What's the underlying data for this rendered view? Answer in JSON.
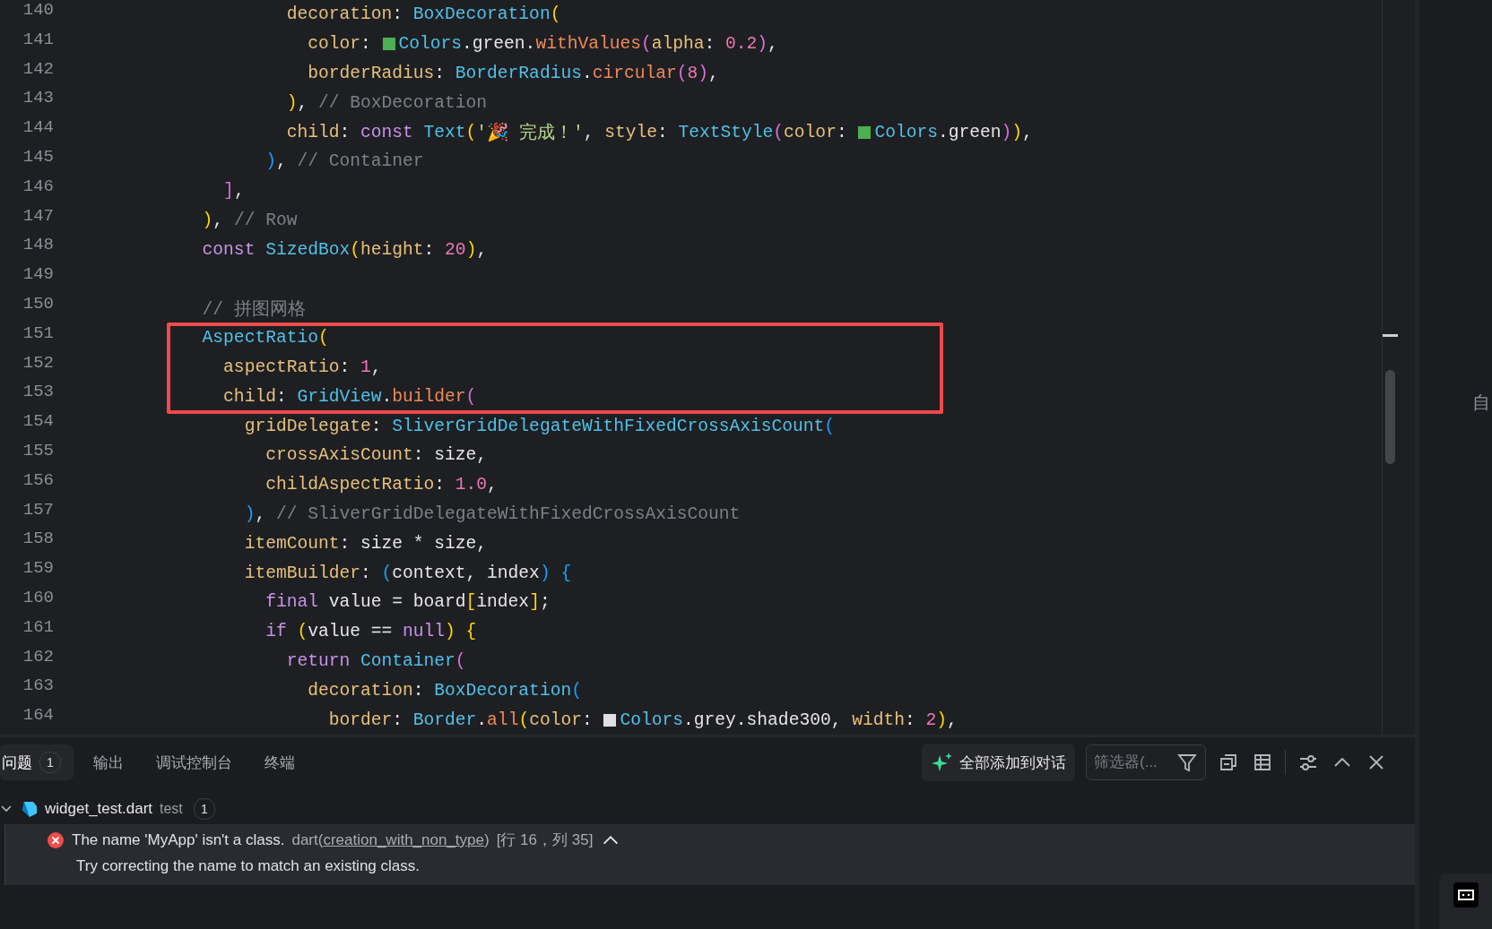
{
  "editor": {
    "lines": [
      {
        "number": "140",
        "tokens": [
          {
            "kind": "prop",
            "s": "                  decoration"
          },
          {
            "kind": "text",
            "s": ": "
          },
          {
            "kind": "type",
            "s": "BoxDecoration"
          },
          {
            "kind": "b1",
            "s": "("
          }
        ]
      },
      {
        "number": "141",
        "tokens": [
          {
            "kind": "prop",
            "s": "                    color"
          },
          {
            "kind": "text",
            "s": ": "
          },
          {
            "kind": "swatch",
            "color": "#4caf50"
          },
          {
            "kind": "type",
            "s": "Colors"
          },
          {
            "kind": "text",
            "s": ".green."
          },
          {
            "kind": "fn",
            "s": "withValues"
          },
          {
            "kind": "b2",
            "s": "("
          },
          {
            "kind": "prop",
            "s": "alpha"
          },
          {
            "kind": "text",
            "s": ": "
          },
          {
            "kind": "num",
            "s": "0.2"
          },
          {
            "kind": "b2",
            "s": ")"
          },
          {
            "kind": "text",
            "s": ","
          }
        ]
      },
      {
        "number": "142",
        "tokens": [
          {
            "kind": "prop",
            "s": "                    borderRadius"
          },
          {
            "kind": "text",
            "s": ": "
          },
          {
            "kind": "type",
            "s": "BorderRadius"
          },
          {
            "kind": "text",
            "s": "."
          },
          {
            "kind": "fn",
            "s": "circular"
          },
          {
            "kind": "b2",
            "s": "("
          },
          {
            "kind": "num",
            "s": "8"
          },
          {
            "kind": "b2",
            "s": ")"
          },
          {
            "kind": "text",
            "s": ","
          }
        ]
      },
      {
        "number": "143",
        "tokens": [
          {
            "kind": "b1",
            "s": "                  )"
          },
          {
            "kind": "text",
            "s": ", "
          },
          {
            "kind": "comment",
            "s": "// BoxDecoration"
          }
        ]
      },
      {
        "number": "144",
        "tokens": [
          {
            "kind": "prop",
            "s": "                  child"
          },
          {
            "kind": "text",
            "s": ": "
          },
          {
            "kind": "kw",
            "s": "const "
          },
          {
            "kind": "type",
            "s": "Text"
          },
          {
            "kind": "b1",
            "s": "("
          },
          {
            "kind": "str",
            "s": "'🎉 完成！'"
          },
          {
            "kind": "text",
            "s": ", "
          },
          {
            "kind": "prop",
            "s": "style"
          },
          {
            "kind": "text",
            "s": ": "
          },
          {
            "kind": "type",
            "s": "TextStyle"
          },
          {
            "kind": "b2",
            "s": "("
          },
          {
            "kind": "prop",
            "s": "color"
          },
          {
            "kind": "text",
            "s": ": "
          },
          {
            "kind": "swatch",
            "color": "#4caf50"
          },
          {
            "kind": "type",
            "s": "Colors"
          },
          {
            "kind": "text",
            "s": ".green"
          },
          {
            "kind": "b2",
            "s": ")"
          },
          {
            "kind": "b1",
            "s": ")"
          },
          {
            "kind": "text",
            "s": ","
          }
        ]
      },
      {
        "number": "145",
        "tokens": [
          {
            "kind": "b3",
            "s": "                )"
          },
          {
            "kind": "text",
            "s": ", "
          },
          {
            "kind": "comment",
            "s": "// Container"
          }
        ]
      },
      {
        "number": "146",
        "tokens": [
          {
            "kind": "b2",
            "s": "            ]"
          },
          {
            "kind": "text",
            "s": ","
          }
        ]
      },
      {
        "number": "147",
        "tokens": [
          {
            "kind": "b1",
            "s": "          )"
          },
          {
            "kind": "text",
            "s": ", "
          },
          {
            "kind": "comment",
            "s": "// Row"
          }
        ]
      },
      {
        "number": "148",
        "tokens": [
          {
            "kind": "kw",
            "s": "          const "
          },
          {
            "kind": "type",
            "s": "SizedBox"
          },
          {
            "kind": "b1",
            "s": "("
          },
          {
            "kind": "prop",
            "s": "height"
          },
          {
            "kind": "text",
            "s": ": "
          },
          {
            "kind": "num",
            "s": "20"
          },
          {
            "kind": "b1",
            "s": ")"
          },
          {
            "kind": "text",
            "s": ","
          }
        ]
      },
      {
        "number": "149"
      },
      {
        "number": "150",
        "tokens": [
          {
            "kind": "comment",
            "s": "          // 拼图网格"
          }
        ]
      },
      {
        "number": "151",
        "boxed": true,
        "tokens": [
          {
            "kind": "type",
            "s": "          AspectRatio"
          },
          {
            "kind": "b1",
            "s": "("
          }
        ]
      },
      {
        "number": "152",
        "boxed": true,
        "tokens": [
          {
            "kind": "prop",
            "s": "            aspectRatio"
          },
          {
            "kind": "text",
            "s": ": "
          },
          {
            "kind": "num",
            "s": "1"
          },
          {
            "kind": "text",
            "s": ","
          }
        ]
      },
      {
        "number": "153",
        "boxed": true,
        "tokens": [
          {
            "kind": "prop",
            "s": "            child"
          },
          {
            "kind": "text",
            "s": ": "
          },
          {
            "kind": "type",
            "s": "GridView"
          },
          {
            "kind": "text",
            "s": "."
          },
          {
            "kind": "fn",
            "s": "builder"
          },
          {
            "kind": "b2",
            "s": "("
          }
        ]
      },
      {
        "number": "154",
        "tokens": [
          {
            "kind": "prop",
            "s": "              gridDelegate"
          },
          {
            "kind": "text",
            "s": ": "
          },
          {
            "kind": "type",
            "s": "SliverGridDelegateWithFixedCrossAxisCount"
          },
          {
            "kind": "b3",
            "s": "("
          }
        ]
      },
      {
        "number": "155",
        "tokens": [
          {
            "kind": "prop",
            "s": "                crossAxisCount"
          },
          {
            "kind": "text",
            "s": ": size,"
          }
        ]
      },
      {
        "number": "156",
        "tokens": [
          {
            "kind": "prop",
            "s": "                childAspectRatio"
          },
          {
            "kind": "text",
            "s": ": "
          },
          {
            "kind": "num",
            "s": "1.0"
          },
          {
            "kind": "text",
            "s": ","
          }
        ]
      },
      {
        "number": "157",
        "tokens": [
          {
            "kind": "b3",
            "s": "              )"
          },
          {
            "kind": "text",
            "s": ", "
          },
          {
            "kind": "comment",
            "s": "// SliverGridDelegateWithFixedCrossAxisCount"
          }
        ]
      },
      {
        "number": "158",
        "tokens": [
          {
            "kind": "prop",
            "s": "              itemCount"
          },
          {
            "kind": "text",
            "s": ": size * size,"
          }
        ]
      },
      {
        "number": "159",
        "tokens": [
          {
            "kind": "prop",
            "s": "              itemBuilder"
          },
          {
            "kind": "text",
            "s": ": "
          },
          {
            "kind": "b3",
            "s": "("
          },
          {
            "kind": "text",
            "s": "context, index"
          },
          {
            "kind": "b3",
            "s": ")"
          },
          {
            "kind": "b3",
            "s": " {"
          }
        ]
      },
      {
        "number": "160",
        "tokens": [
          {
            "kind": "kw",
            "s": "                final "
          },
          {
            "kind": "text",
            "s": "value = board"
          },
          {
            "kind": "b1",
            "s": "["
          },
          {
            "kind": "text",
            "s": "index"
          },
          {
            "kind": "b1",
            "s": "]"
          },
          {
            "kind": "text",
            "s": ";"
          }
        ]
      },
      {
        "number": "161",
        "tokens": [
          {
            "kind": "kw",
            "s": "                if "
          },
          {
            "kind": "b1",
            "s": "("
          },
          {
            "kind": "text",
            "s": "value == "
          },
          {
            "kind": "kw",
            "s": "null"
          },
          {
            "kind": "b1",
            "s": ")"
          },
          {
            "kind": "b1",
            "s": " {"
          }
        ]
      },
      {
        "number": "162",
        "tokens": [
          {
            "kind": "kw",
            "s": "                  return "
          },
          {
            "kind": "type",
            "s": "Container"
          },
          {
            "kind": "b2",
            "s": "("
          }
        ]
      },
      {
        "number": "163",
        "tokens": [
          {
            "kind": "prop",
            "s": "                    decoration"
          },
          {
            "kind": "text",
            "s": ": "
          },
          {
            "kind": "type",
            "s": "BoxDecoration"
          },
          {
            "kind": "b3",
            "s": "("
          }
        ]
      },
      {
        "number": "164",
        "tokens": [
          {
            "kind": "prop",
            "s": "                      border"
          },
          {
            "kind": "text",
            "s": ": "
          },
          {
            "kind": "type",
            "s": "Border"
          },
          {
            "kind": "text",
            "s": "."
          },
          {
            "kind": "fn",
            "s": "all"
          },
          {
            "kind": "b1",
            "s": "("
          },
          {
            "kind": "prop",
            "s": "color"
          },
          {
            "kind": "text",
            "s": ": "
          },
          {
            "kind": "swatch",
            "color": "#e0e0e0"
          },
          {
            "kind": "type",
            "s": "Colors"
          },
          {
            "kind": "text",
            "s": ".grey.shade300, "
          },
          {
            "kind": "prop",
            "s": "width"
          },
          {
            "kind": "text",
            "s": ": "
          },
          {
            "kind": "num",
            "s": "2"
          },
          {
            "kind": "b1",
            "s": ")"
          },
          {
            "kind": "text",
            "s": ","
          }
        ]
      }
    ]
  },
  "panel": {
    "tabs": [
      {
        "label": "问题",
        "badge": "1",
        "selected": true
      },
      {
        "label": "输出",
        "selected": false
      },
      {
        "label": "调试控制台",
        "selected": false
      },
      {
        "label": "终端",
        "selected": false
      }
    ],
    "add_to_chat_button": "全部添加到对话",
    "filter": {
      "placeholder": "筛选器(..."
    },
    "problems": [
      {
        "file": "widget_test.dart",
        "folder": "test",
        "count": "1",
        "expanded": true,
        "children": [
          {
            "kind": "error",
            "selected": true,
            "message": "The name 'MyApp' isn't a class.",
            "source": "dart(",
            "code": "creation_with_non_type",
            "source_end": ")",
            "location": "[行 16，列 35]",
            "detail": "Try correcting the name to match an existing class."
          }
        ]
      }
    ]
  },
  "side_panel": {
    "text": "自"
  }
}
